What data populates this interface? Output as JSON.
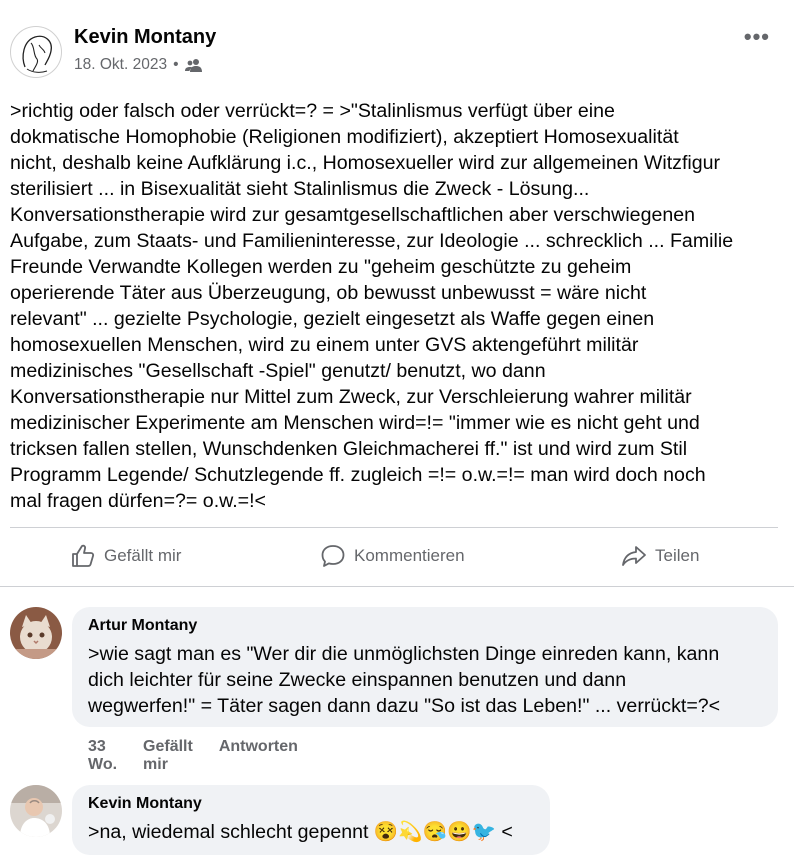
{
  "post": {
    "author": "Kevin Montany",
    "date": "18. Okt. 2023",
    "separator": "•",
    "audience_icon": "friends-icon",
    "more_label": "•••",
    "text": ">richtig oder falsch oder verrückt=? = >\"Stalinlismus verfügt über eine\ndokmatische Homophobie (Religionen modifiziert), akzeptiert Homosexualität\nnicht, deshalb keine Aufklärung i.c., Homosexueller wird zur allgemeinen Witzfigur\nsterilisiert ... in Bisexualität sieht Stalinlismus die Zweck - Lösung...\nKonversationstherapie wird zur gesamtgesellschaftlichen aber verschwiegenen\nAufgabe, zum Staats- und Familieninteresse, zur Ideologie ... schrecklich ... Familie\nFreunde Verwandte Kollegen werden zu \"geheim geschützte zu geheim\noperierende  Täter aus Überzeugung, ob bewusst unbewusst = wäre nicht\nrelevant\" ... gezielte Psychologie, gezielt eingesetzt als Waffe gegen einen\nhomosexuellen Menschen, wird zu einem unter GVS aktengeführt militär\nmedizinisches \"Gesellschaft -Spiel\" genutzt/ benutzt, wo dann\nKonversationstherapie nur Mittel zum Zweck, zur Verschleierung wahrer militär\nmedizinischer Experimente am Menschen wird=!= \"immer wie es nicht geht und\ntricksen fallen stellen, Wunschdenken Gleichmacherei ff.\" ist und wird zum Stil\nProgramm Legende/ Schutzlegende ff. zugleich =!= o.w.=!= man wird doch noch\nmal fragen dürfen=?= o.w.=!<"
  },
  "actions": {
    "like": "Gefällt mir",
    "comment": "Kommentieren",
    "share": "Teilen"
  },
  "comments": [
    {
      "author": "Artur Montany",
      "text": ">wie sagt man es \"Wer dir die unmöglichsten Dinge einreden kann, kann\ndich leichter für seine Zwecke einspannen benutzen und dann\nwegwerfen!\" = Täter sagen dann dazu \"So ist das Leben!\" ... verrückt=?<",
      "time": "33 Wo.",
      "like": "Gefällt mir",
      "reply": "Antworten"
    },
    {
      "author": "Kevin Montany",
      "text": ">na, wiedemal schlecht gepennt 😵💫😪😀🐦 <"
    }
  ],
  "colors": {
    "secondary_text": "#65676b",
    "bubble_bg": "#f0f2f5",
    "divider": "#ced0d4"
  }
}
